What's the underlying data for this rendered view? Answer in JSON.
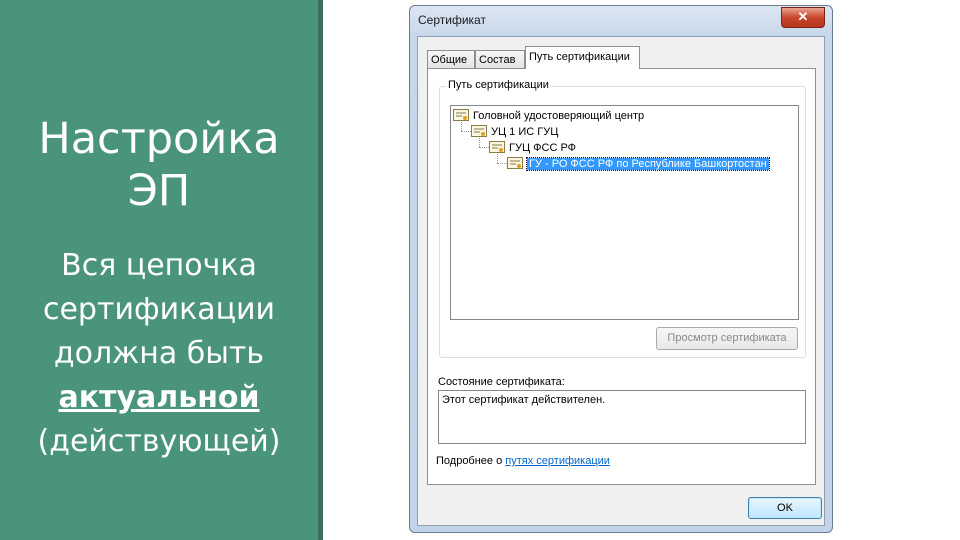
{
  "slide": {
    "title_lines": [
      "Настройка",
      "ЭП"
    ],
    "body": {
      "line1": "Вся цепочка",
      "line2": "сертификации",
      "line3": "должна быть",
      "line4": "актуальной",
      "line5": "(действующей)"
    }
  },
  "dialog": {
    "title": "Сертификат",
    "close_glyph": "✕",
    "tabs": [
      {
        "label": "Общие",
        "active": false
      },
      {
        "label": "Состав",
        "active": false
      },
      {
        "label": "Путь сертификации",
        "active": true
      }
    ],
    "path_group_label": "Путь сертификации",
    "tree": [
      {
        "label": "Головной удостоверяющий центр",
        "level": 0,
        "selected": false
      },
      {
        "label": "УЦ 1 ИС ГУЦ",
        "level": 1,
        "selected": false
      },
      {
        "label": "ГУЦ ФСС РФ",
        "level": 2,
        "selected": false
      },
      {
        "label": "ГУ - РО ФСС РФ по Республике Башкортостан",
        "level": 3,
        "selected": true
      }
    ],
    "view_cert_button": "Просмотр сертификата",
    "status_label": "Состояние сертификата:",
    "status_text": "Этот сертификат действителен.",
    "more_prefix": "Подробнее о ",
    "more_link": "путях сертификации",
    "ok_button": "OK",
    "colors": {
      "slide_bg": "#4a9479",
      "selection": "#3399ff",
      "link": "#0066cc"
    }
  }
}
